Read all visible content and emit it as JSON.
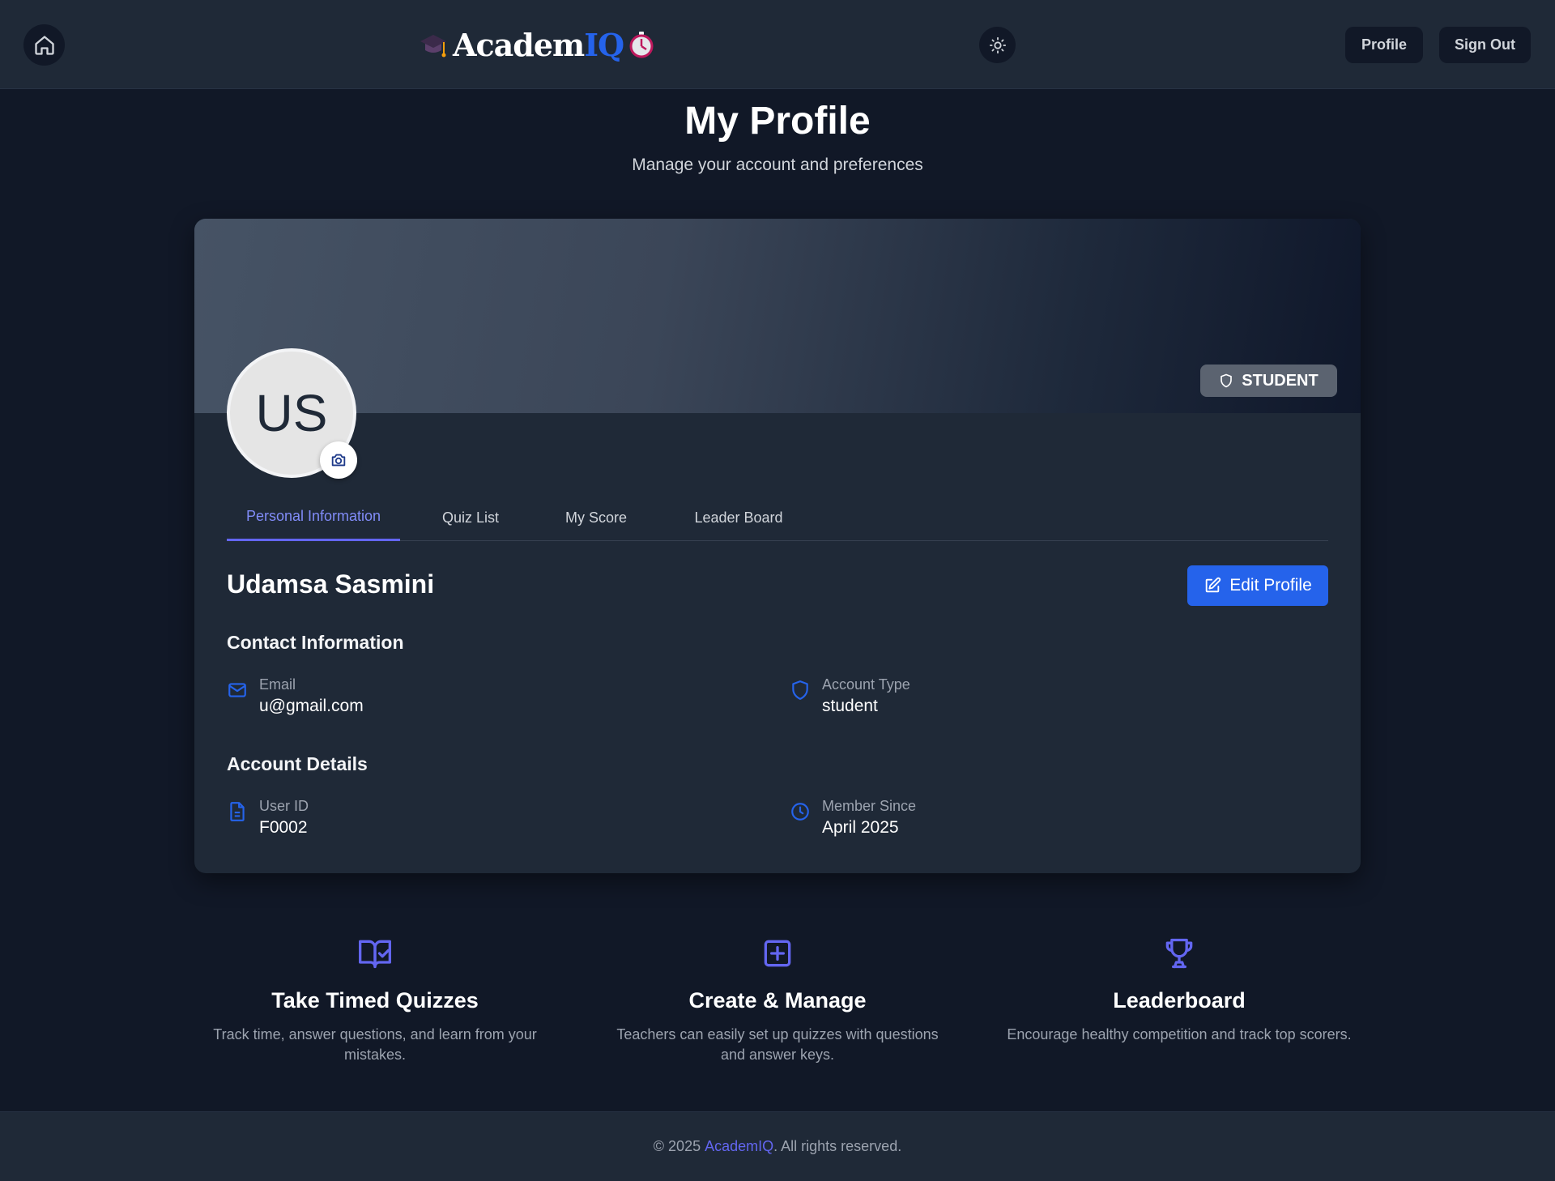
{
  "header": {
    "logo_prefix": "Academ",
    "logo_suffix": "IQ",
    "profile_label": "Profile",
    "signout_label": "Sign Out"
  },
  "page": {
    "title": "My Profile",
    "subtitle": "Manage your account and preferences"
  },
  "profile": {
    "initials": "US",
    "role_badge": "STUDENT",
    "name": "Udamsa Sasmini",
    "edit_label": "Edit Profile"
  },
  "tabs": [
    {
      "label": "Personal Information",
      "active": true
    },
    {
      "label": "Quiz List",
      "active": false
    },
    {
      "label": "My Score",
      "active": false
    },
    {
      "label": "Leader Board",
      "active": false
    }
  ],
  "contact": {
    "heading": "Contact Information",
    "email_label": "Email",
    "email_value": "u@gmail.com",
    "account_type_label": "Account Type",
    "account_type_value": "student"
  },
  "account": {
    "heading": "Account Details",
    "user_id_label": "User ID",
    "user_id_value": "F0002",
    "member_since_label": "Member Since",
    "member_since_value": "April 2025"
  },
  "features": [
    {
      "icon": "book-check-icon",
      "title": "Take Timed Quizzes",
      "description": "Track time, answer questions, and learn from your mistakes."
    },
    {
      "icon": "plus-square-icon",
      "title": "Create & Manage",
      "description": "Teachers can easily set up quizzes with questions and answer keys."
    },
    {
      "icon": "trophy-icon",
      "title": "Leaderboard",
      "description": "Encourage healthy competition and track top scorers."
    }
  ],
  "footer": {
    "prefix": "© 2025 ",
    "brand": "AcademIQ",
    "suffix": ". All rights reserved."
  },
  "colors": {
    "background": "#111827",
    "surface": "#1f2937",
    "accent": "#2563eb",
    "indigo": "#6366f1"
  }
}
